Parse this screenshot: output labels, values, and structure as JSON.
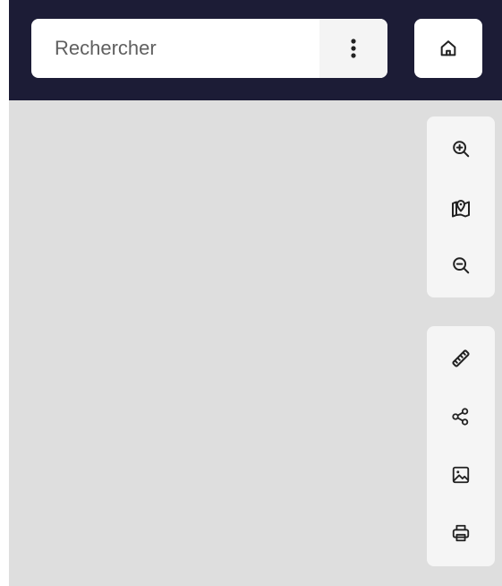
{
  "search": {
    "placeholder": "Rechercher",
    "value": ""
  },
  "icons": {
    "menu": "vertical-dots-icon",
    "home": "home-icon",
    "zoom_in": "zoom-in-icon",
    "locate": "map-pin-icon",
    "zoom_out": "zoom-out-icon",
    "measure": "ruler-icon",
    "share": "share-icon",
    "image": "image-icon",
    "print": "printer-icon"
  },
  "colors": {
    "header": "#1c1c36",
    "map_background": "#dedede",
    "panel": "#f5f5f5",
    "icon": "#222222"
  }
}
